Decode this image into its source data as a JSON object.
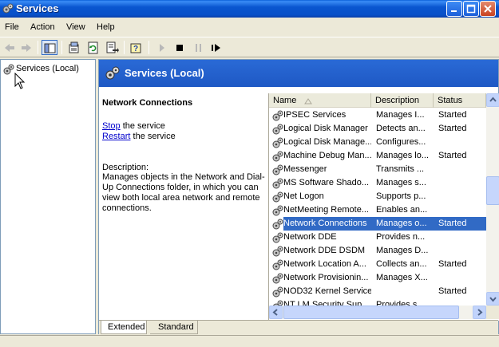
{
  "window": {
    "title": "Services",
    "app_icon": "gears-icon"
  },
  "menu": [
    "File",
    "Action",
    "View",
    "Help"
  ],
  "toolbar": {
    "buttons": [
      "back-icon",
      "forward-icon",
      "show-hide-tree-icon",
      "properties-icon",
      "refresh-icon",
      "export-list-icon",
      "help-icon",
      "start-service-icon",
      "stop-service-icon",
      "pause-service-icon",
      "restart-service-icon"
    ]
  },
  "tree": {
    "root": "Services (Local)"
  },
  "header": {
    "title": "Services (Local)"
  },
  "detail": {
    "service_name": "Network Connections",
    "stop_link": "Stop",
    "stop_suffix": " the service",
    "restart_link": "Restart",
    "restart_suffix": " the service",
    "description_label": "Description:",
    "description_text": "Manages objects in the Network and Dial-Up Connections folder, in which you can view both local area network and remote connections."
  },
  "list": {
    "columns": {
      "name": "Name",
      "description": "Description",
      "status": "Status"
    },
    "rows": [
      {
        "name": "IPSEC Services",
        "description": "Manages I...",
        "status": "Started"
      },
      {
        "name": "Logical Disk Manager",
        "description": "Detects an...",
        "status": "Started"
      },
      {
        "name": "Logical Disk Manage...",
        "description": "Configures...",
        "status": ""
      },
      {
        "name": "Machine Debug Man...",
        "description": "Manages lo...",
        "status": "Started"
      },
      {
        "name": "Messenger",
        "description": "Transmits ...",
        "status": ""
      },
      {
        "name": "MS Software Shado...",
        "description": "Manages s...",
        "status": ""
      },
      {
        "name": "Net Logon",
        "description": "Supports p...",
        "status": ""
      },
      {
        "name": "NetMeeting Remote...",
        "description": "Enables an...",
        "status": ""
      },
      {
        "name": "Network Connections",
        "description": "Manages o...",
        "status": "Started"
      },
      {
        "name": "Network DDE",
        "description": "Provides n...",
        "status": ""
      },
      {
        "name": "Network DDE DSDM",
        "description": "Manages D...",
        "status": ""
      },
      {
        "name": "Network Location A...",
        "description": "Collects an...",
        "status": "Started"
      },
      {
        "name": "Network Provisionin...",
        "description": "Manages X...",
        "status": ""
      },
      {
        "name": "NOD32 Kernel Service",
        "description": "",
        "status": "Started"
      },
      {
        "name": "NT LM Security Sup...",
        "description": "Provides s...",
        "status": ""
      }
    ]
  },
  "tabs": [
    "Extended",
    "Standard"
  ],
  "colors": {
    "selection": "#316AC5",
    "titlebar": "#0A56D0",
    "header": "#2A6AD6"
  }
}
